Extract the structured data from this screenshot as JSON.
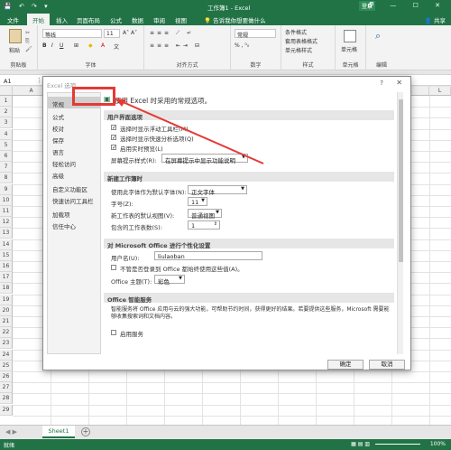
{
  "titlebar": {
    "title": "工作簿1 - Excel",
    "login": "登录",
    "quick_access": "💾 ↶ ↷ ▾",
    "win_buttons": "🗗 — ☐ ✕"
  },
  "tabs": [
    "文件",
    "开始",
    "插入",
    "页面布局",
    "公式",
    "数据",
    "审阅",
    "视图",
    "帮助"
  ],
  "active_tab": "开始",
  "tellme": "告诉我你想要做什么",
  "share": "共享",
  "ribbon": {
    "paste": "粘贴",
    "clipboard": "剪贴板",
    "font_name": "等线",
    "font_size": "11",
    "font_group": "字体",
    "align_group": "对齐方式",
    "number_format": "常规",
    "number_group": "数字",
    "cond_format": "条件格式",
    "table_format": "套用表格格式",
    "cell_style": "单元格样式",
    "styles_group": "样式",
    "cells_label": "单元格",
    "cells_group": "单元格",
    "editing": "编辑"
  },
  "formula_bar": {
    "name_box": "A1"
  },
  "columns": [
    "A",
    "B",
    "C",
    "D",
    "E",
    "F",
    "G",
    "H",
    "I",
    "J",
    "K",
    "L"
  ],
  "rows": [
    "1",
    "2",
    "3",
    "4",
    "5",
    "6",
    "7",
    "8",
    "9",
    "10",
    "11",
    "12",
    "13",
    "14",
    "15",
    "16",
    "17",
    "18",
    "19",
    "20",
    "21",
    "22",
    "23",
    "24",
    "25",
    "26",
    "27",
    "28",
    "29"
  ],
  "sheet_tab": "Sheet1",
  "status": {
    "ready": "就绪",
    "zoom": "100%"
  },
  "dialog": {
    "title": "Excel 选项",
    "help": "?",
    "close": "✕",
    "nav": [
      "常规",
      "公式",
      "校对",
      "保存",
      "语言",
      "轻松访问",
      "高级",
      "自定义功能区",
      "快速访问工具栏",
      "加载项",
      "信任中心"
    ],
    "header": "使用 Excel 时采用的常规选项。",
    "sections": {
      "ui": "用户界面选项",
      "new_wb": "新建工作簿时",
      "personalize": "对 Microsoft Office 进行个性化设置",
      "intelligent": "Office 智能服务"
    },
    "ui_options": {
      "mini_toolbar": "选择时显示浮动工具栏(M)",
      "quick_analysis": "选择时显示快速分析选项(Q)",
      "live_preview": "启用实时预览(L)",
      "tooltip_style_label": "屏幕提示样式(R):",
      "tooltip_style_value": "在屏幕提示中显示功能说明"
    },
    "new_wb_options": {
      "font_label": "使用此字体作为默认字体(N):",
      "font_value": "正文字体",
      "size_label": "字号(Z):",
      "size_value": "11",
      "view_label": "新工作表的默认视图(V):",
      "view_value": "普通视图",
      "sheets_label": "包含的工作表数(S):",
      "sheets_value": "1"
    },
    "personalize_options": {
      "username_label": "用户名(U):",
      "username_value": "liulaoban",
      "always_use": "不管是否登录到 Office 都始终使用这些值(A)。",
      "theme_label": "Office 主题(T):",
      "theme_value": "彩色"
    },
    "intelligent_text": "智能服务将 Office 应用与云的强大功能，可帮助节约时间，获得更好的结果。若要提供这些服务，Microsoft 需要能够收集搜索词和文档内容。",
    "enable_services": "启用服务",
    "ok": "确定",
    "cancel": "取消"
  },
  "annotation_color": "#e53935",
  "accent": "#217346"
}
